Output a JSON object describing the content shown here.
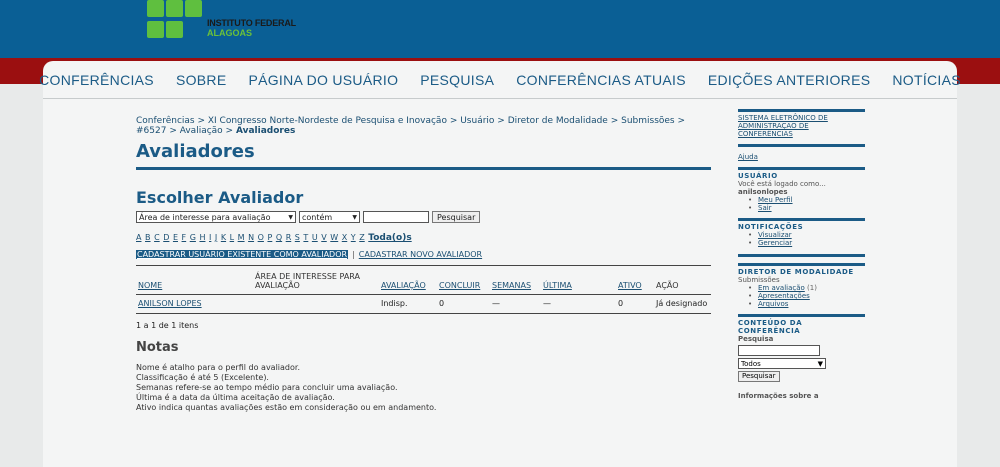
{
  "logo": {
    "line1": "INSTITUTO FEDERAL",
    "line2": "ALAGOAS",
    "color": "#5fbf3f"
  },
  "nav": [
    "CONFERÊNCIAS",
    "SOBRE",
    "PÁGINA DO USUÁRIO",
    "PESQUISA",
    "CONFERÊNCIAS ATUAIS",
    "EDIÇÕES ANTERIORES",
    "NOTÍCIAS"
  ],
  "breadcrumb": {
    "items": [
      "Conferências",
      "XI Congresso Norte-Nordeste de Pesquisa e Inovação",
      "Usuário",
      "Diretor de Modalidade",
      "Submissões",
      "#6527",
      "Avaliação"
    ],
    "current": "Avaliadores",
    "separator": " > "
  },
  "page_title": "Avaliadores",
  "section_title": "Escolher Avaliador",
  "search": {
    "field_select": "Área de interesse para avaliação",
    "match_select": "contém",
    "query_value": "",
    "button": "Pesquisar"
  },
  "alphabet": [
    "A",
    "B",
    "C",
    "D",
    "E",
    "F",
    "G",
    "H",
    "I",
    "J",
    "K",
    "L",
    "M",
    "N",
    "O",
    "P",
    "Q",
    "R",
    "S",
    "T",
    "U",
    "V",
    "W",
    "X",
    "Y",
    "Z"
  ],
  "alphabet_all": "Toda(o)s",
  "actions": {
    "existing": "CADASTRAR USUÁRIO EXISTENTE COMO AVALIADOR",
    "separator": "|",
    "new": "CADASTRAR NOVO AVALIADOR"
  },
  "table": {
    "headers": [
      "NOME",
      "ÁREA DE INTERESSE PARA AVALIAÇÃO",
      "AVALIAÇÃO",
      "CONCLUIR",
      "SEMANAS",
      "ÚLTIMA",
      "ATIVO",
      "AÇÃO"
    ],
    "rows": [
      {
        "name": "ANILSON LOPES",
        "area": "",
        "rating": "Indisp.",
        "done": "0",
        "weeks": "—",
        "last": "—",
        "active": "0",
        "action": "Já designado"
      }
    ],
    "count": "1 a 1 de 1 itens"
  },
  "notes": {
    "title": "Notas",
    "lines": [
      "Nome é atalho para o perfil do avaliador.",
      "Classificação é até 5 (Excelente).",
      "Semanas refere-se ao tempo médio para concluir uma avaliação.",
      "Última é a data da última aceitação de avaliação.",
      "Ativo indica quantas avaliações estão em consideração ou em andamento."
    ]
  },
  "sidebar": {
    "system_title": "SISTEMA ELETRÔNICO DE ADMINISTRAÇÃO DE CONFERÊNCIAS",
    "help": "Ajuda",
    "user": {
      "heading": "USUÁRIO",
      "logged_as": "Você está logado como...",
      "username": "anilsonlopes",
      "links": [
        "Meu Perfil",
        "Sair"
      ]
    },
    "notifications": {
      "heading": "NOTIFICAÇÕES",
      "links": [
        "Visualizar",
        "Gerenciar"
      ]
    },
    "director": {
      "heading": "DIRETOR DE MODALIDADE",
      "sub": "Submissões",
      "links": [
        "Em avaliação",
        "Apresentações",
        "Arquivos"
      ],
      "count": "(1)"
    },
    "content": {
      "heading": "CONTEÚDO DA CONFERÊNCIA",
      "search_label": "Pesquisa",
      "select": "Todos",
      "button": "Pesquisar",
      "more": "Informações sobre a"
    }
  }
}
